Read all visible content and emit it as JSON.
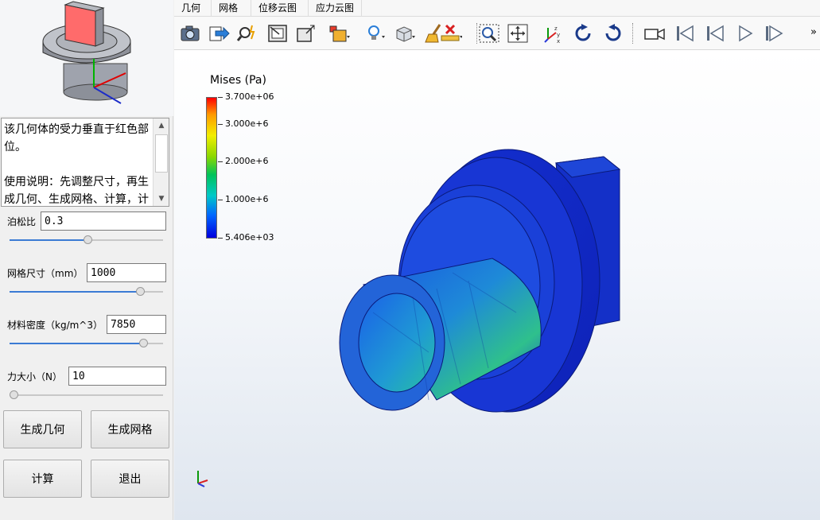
{
  "menu": [
    "几何",
    "网格",
    "位移云图",
    "应力云图"
  ],
  "description": {
    "para1": "该几何体的受力垂直于红色部位。",
    "para2": "使用说明：先调整尺寸，再生成几何、生成网格、计算，计算完成后可在右方查"
  },
  "params": [
    {
      "label": "泊松比",
      "value": "0.3",
      "slider_fraction": 0.5
    },
    {
      "label": "网格尺寸（mm）",
      "value": "1000",
      "slider_fraction": 0.85
    },
    {
      "label": "材料密度（kg/m^3）",
      "value": "7850",
      "slider_fraction": 0.87
    },
    {
      "label": "力大小（N）",
      "value": "10",
      "slider_fraction": 0.0
    }
  ],
  "buttons": {
    "gen_geometry": "生成几何",
    "gen_mesh": "生成网格",
    "compute": "计算",
    "exit": "退出"
  },
  "colorbar": {
    "title": "Mises (Pa)",
    "max": "3.700e+06",
    "t3": "3.000e+6",
    "t2": "2.000e+6",
    "t1": "1.000e+6",
    "min": "5.406e+03"
  },
  "toolbar_icons": [
    "camera-icon",
    "export-icon",
    "zoom-magic-icon",
    "fit-view-icon",
    "resize-icon",
    "display-mode-icon",
    "light-icon",
    "box-view-icon",
    "clean-icon",
    "ruler-delete-icon",
    "zoom-box-icon",
    "pan-icon",
    "axes-icon",
    "rotate-left-icon",
    "rotate-right-icon",
    "video-icon",
    "first-frame-icon",
    "prev-frame-icon",
    "play-icon",
    "next-frame-icon"
  ],
  "toolbar_overflow": "»",
  "colors": {
    "accent": "#3b7bd4",
    "model_blue": "#1a3fd6",
    "highlight_red": "#ff6b6b"
  }
}
